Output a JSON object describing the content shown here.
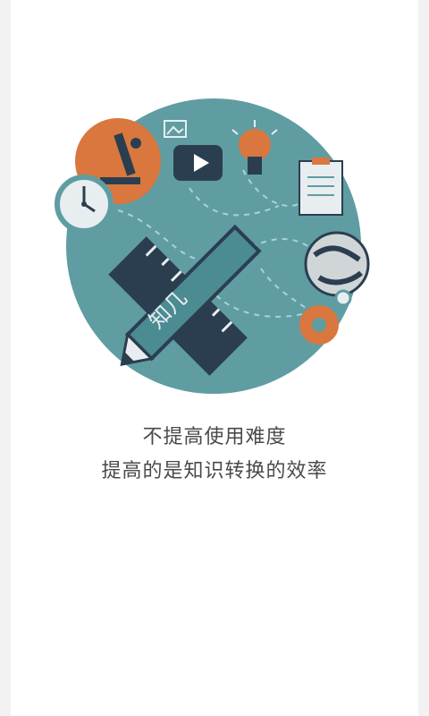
{
  "illustration": {
    "brand_text": "知几",
    "colors": {
      "circle": "#5f9da3",
      "dark": "#2b3e50",
      "orange": "#d9773f",
      "light": "#e8eef0"
    }
  },
  "tagline": {
    "line1": "不提高使用难度",
    "line2": "提高的是知识转换的效率"
  }
}
